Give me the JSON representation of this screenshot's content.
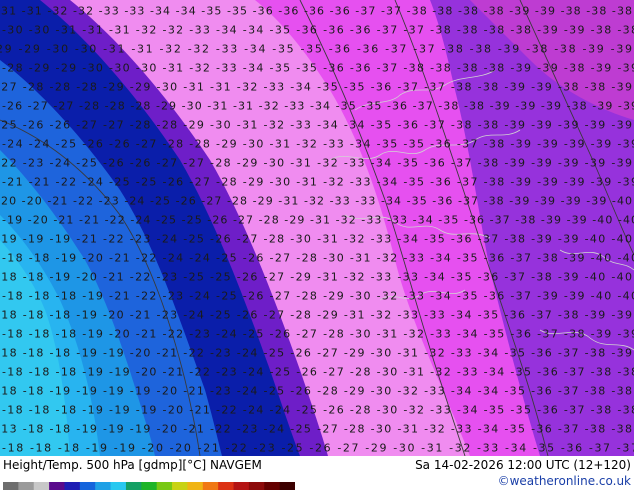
{
  "footer": {
    "title": "Height/Temp. 500 hPa [gdmp][°C] NAVGEM",
    "datetime": "Sa 14-02-2026 12:00 UTC (12+120)",
    "credit": "©weatheronline.co.uk"
  },
  "colorbar": {
    "ticks": [
      "-54",
      "-48",
      "-42",
      "-38",
      "-30",
      "-24",
      "-18",
      "-12",
      "-6",
      "0",
      "6",
      "12",
      "18",
      "24",
      "30",
      "36",
      "42",
      "48",
      "54"
    ],
    "colors": [
      "#6e6e6e",
      "#9a9a9a",
      "#c8c8c8",
      "#5a0a8c",
      "#1e1eb4",
      "#1464dc",
      "#1ea0e6",
      "#28c8f0",
      "#14a064",
      "#1eb428",
      "#78c814",
      "#c8d214",
      "#f0b414",
      "#f07814",
      "#dc3214",
      "#b41414",
      "#8c0a0a",
      "#640000",
      "#3c0000"
    ]
  },
  "map": {
    "colors": {
      "dark_blue": "#0a1eaa",
      "blue": "#1e64dc",
      "mid_blue": "#1e96e6",
      "light_blue": "#28b4f0",
      "cyan": "#32c8f0",
      "violet": "#6e1ec8",
      "purple": "#9632dc",
      "magenta": "#e650f0",
      "pink": "#f08cf0",
      "deep_magenta": "#be3cd2",
      "contour": "#3a3a3a",
      "coast": "#d2d2d2"
    },
    "rows": [
      "-31 -31 -32 -32 -33 -33 -34 -34 -35 -35 -36 -36 -36 -36 -37 -37 -38 -38 -38 -38 -39 -39 -38 -38 -38",
      "-30 -30 -31 -31 -31 -32 -32 -33 -34 -34 -35 -36 -36 -36 -37 -37 -38 -38 -38 -38 -39 -39 -38 -38",
      "29 -29 -30 -30 -31 -31 -32 -32 -33 -34 -35 -35 -36 -36 -37 -37 -38 -38 -39 -38 -38 -39 -39",
      "-28 -29 -29 -30 -30 -30 -31 -32 -33 -34 -35 -35 -36 -36 -37 -38 -38 -38 -38 -39 -39 -38 -39 -39",
      "-27 -28 -28 -28 -29 -29 -30 -31 -31 -32 -33 -34 -35 -35 -36 -37 -37 -38 -38 -39 -39 -38 -38 -39",
      "-26 -27 -27 -28 -28 -28 -29 -30 -31 -31 -32 -33 -34 -35 -35 -36 -37 -38 -38 -39 -39 -39 -38 -39 -39",
      "-25 -26 -26 -27 -27 -28 -28 -29 -30 -31 -32 -33 -34 -34 -35 -36 -37 -38 -38 -39 -39 -39 -39 -39",
      "-24 -24 -25 -26 -26 -27 -28 -28 -29 -30 -31 -32 -33 -34 -35 -35 -36 -37 -38 -39 -39 -39 -39 -39",
      "-22 -23 -24 -25 -26 -26 -27 -27 -28 -29 -30 -31 -32 -33 -34 -35 -36 -37 -38 -39 -39 -39 -39 -39",
      "-21 -21 -22 -24 -25 -25 -26 -27 -28 -29 -30 -31 -32 -33 -34 -35 -36 -37 -38 -39 -39 -39 -39 -39",
      "-20 -20 -21 -22 -23 -24 -25 -26 -27 -28 -29 -31 -32 -33 -33 -34 -35 -36 -37 -38 -39 -39 -39 -39 -40",
      "-19 -20 -21 -21 -22 -24 -25 -25 -26 -27 -28 -29 -31 -32 -33 -33 -34 -35 -36 -37 -38 -39 -39 -40 -40",
      "-19 -19 -19 -21 -22 -23 -24 -25 -26 -27 -28 -30 -31 -32 -33 -34 -35 -36 -37 -38 -39 -39 -40 -40",
      "-18 -18 -19 -20 -21 -22 -24 -24 -25 -26 -27 -28 -30 -31 -32 -33 -34 -35 -36 -37 -38 -39 -40 -40",
      "-18 -18 -19 -20 -21 -22 -23 -25 -25 -26 -27 -29 -31 -32 -33 -33 -34 -35 -36 -37 -38 -39 -40 -40",
      "-18 -18 -18 -19 -21 -22 -23 -24 -25 -26 -27 -28 -29 -30 -32 -33 -34 -35 -36 -37 -39 -39 -40 -40",
      "-18 -18 -18 -19 -20 -21 -23 -24 -25 -26 -27 -28 -29 -31 -32 -33 -33 -34 -35 -36 -37 -38 -39 -39",
      "-18 -18 -18 -19 -20 -21 -22 -23 -24 -25 -26 -27 -28 -30 -31 -32 -33 -34 -35 -36 -37 -38 -39 -39",
      "-18 -18 -18 -19 -19 -20 -21 -22 -23 -24 -25 -26 -27 -29 -30 -31 -32 -33 -34 -35 -36 -37 -38 -39",
      "-18 -18 -18 -19 -19 -20 -21 -22 -23 -24 -25 -26 -27 -28 -30 -31 -32 -33 -34 -35 -36 -37 -38 -38",
      "-18 -18 -19 -19 -19 -19 -20 -21 -23 -24 -25 -26 -28 -29 -30 -32 -33 -34 -34 -35 -36 -37 -38 -38",
      "-18 -18 -18 -19 -19 -19 -20 -21 -22 -24 -24 -25 -26 -28 -30 -32 -33 -34 -35 -35 -36 -37 -38 -38",
      "-13 -18 -18 -19 -19 -19 -20 -21 -22 -23 -24 -25 -27 -28 -30 -31 -32 -33 -34 -35 -36 -37 -38 -38",
      "-18 -18 -18 -19 -19 -20 -20 -21 -22 -23 -25 -26 -27 -29 -30 -31 -32 -33 -34 -35 -36 -37 -37"
    ]
  }
}
